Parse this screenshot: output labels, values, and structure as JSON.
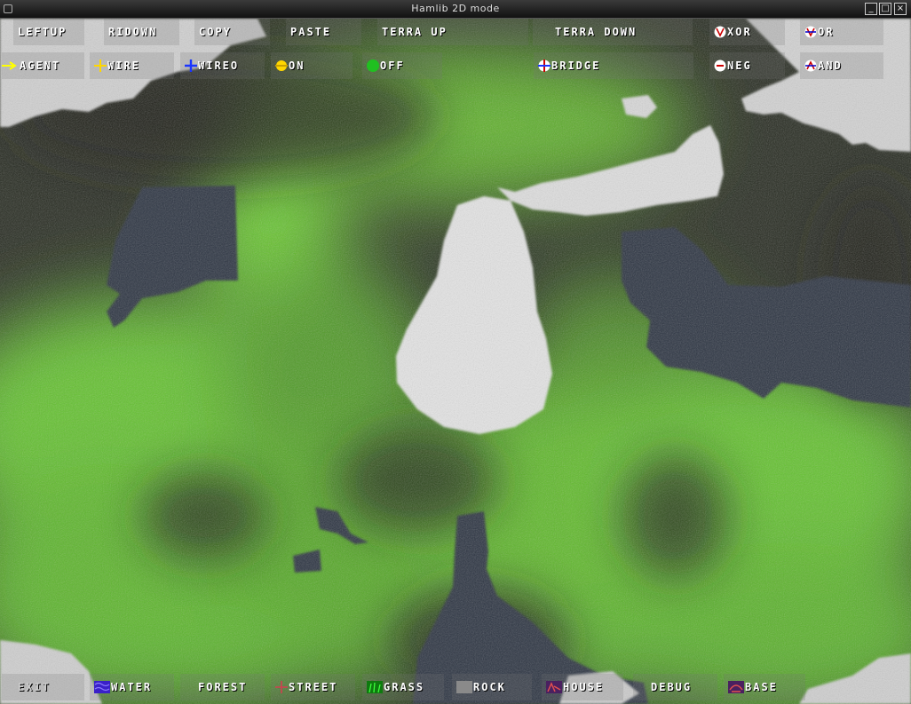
{
  "window": {
    "title": "Hamlib 2D mode"
  },
  "top_row": [
    {
      "label": "LEFTUP"
    },
    {
      "label": "RIDOWN"
    },
    {
      "label": "COPY"
    },
    {
      "label": "PASTE"
    },
    {
      "label": "TERRA UP"
    },
    {
      "label": "TERRA DOWN"
    },
    {
      "label": "XOR",
      "icon": "v-circle-icon"
    },
    {
      "label": "OR",
      "icon": "v-cross-icon"
    }
  ],
  "second_row": [
    {
      "label": "AGENT",
      "icon": "arrow-icon"
    },
    {
      "label": "WIRE",
      "icon": "yellow-cross-icon"
    },
    {
      "label": "WIREO",
      "icon": "blue-cross-icon"
    },
    {
      "label": "ON",
      "icon": "yellow-dot-icon"
    },
    {
      "label": "OFF",
      "icon": "green-dot-icon"
    },
    {
      "label": "BRIDGE",
      "icon": "bridge-icon"
    },
    {
      "label": "NEG",
      "icon": "neg-icon"
    },
    {
      "label": "AND",
      "icon": "and-icon"
    }
  ],
  "bottom_row": [
    {
      "label": "EXIT"
    },
    {
      "label": "WATER",
      "icon": "water-icon"
    },
    {
      "label": "FOREST"
    },
    {
      "label": "STREET",
      "icon": "street-icon"
    },
    {
      "label": "GRASS",
      "icon": "grass-icon"
    },
    {
      "label": "ROCK",
      "icon": "rock-icon"
    },
    {
      "label": "HOUSE",
      "icon": "house-icon"
    },
    {
      "label": "DEBUG"
    },
    {
      "label": "BASE",
      "icon": "base-icon"
    }
  ],
  "colors": {
    "grass": "#63c22e",
    "forest": "#262a20",
    "rock": "#d8d8d8",
    "water": "#2a3040"
  }
}
